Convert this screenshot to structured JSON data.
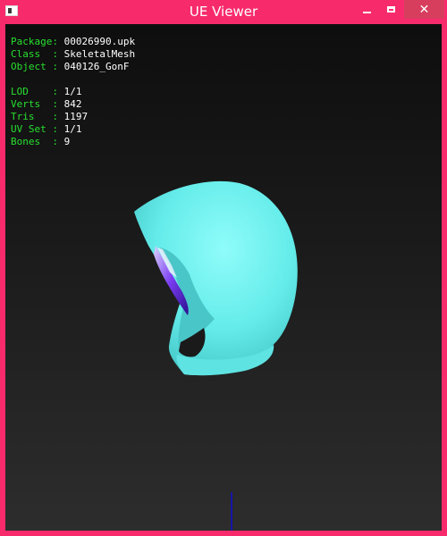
{
  "window": {
    "title": "UE Viewer",
    "close_glyph": "✕"
  },
  "info": {
    "package": {
      "label": "Package:",
      "value": "00026990.upk"
    },
    "class": {
      "label": "Class  :",
      "value": "SkeletalMesh"
    },
    "object": {
      "label": "Object :",
      "value": "040126_GonF"
    },
    "lod": {
      "label": "LOD    :",
      "value": "1/1"
    },
    "verts": {
      "label": "Verts  :",
      "value": "842"
    },
    "tris": {
      "label": "Tris   :",
      "value": "1197"
    },
    "uvset": {
      "label": "UV Set :",
      "value": "1/1"
    },
    "bones": {
      "label": "Bones  :",
      "value": "9"
    }
  },
  "colors": {
    "frame": "#f72b6c",
    "info_label": "#27e02f",
    "info_value": "#ffffff",
    "mesh": "#6ff3f1",
    "axis": "#1515a8"
  }
}
